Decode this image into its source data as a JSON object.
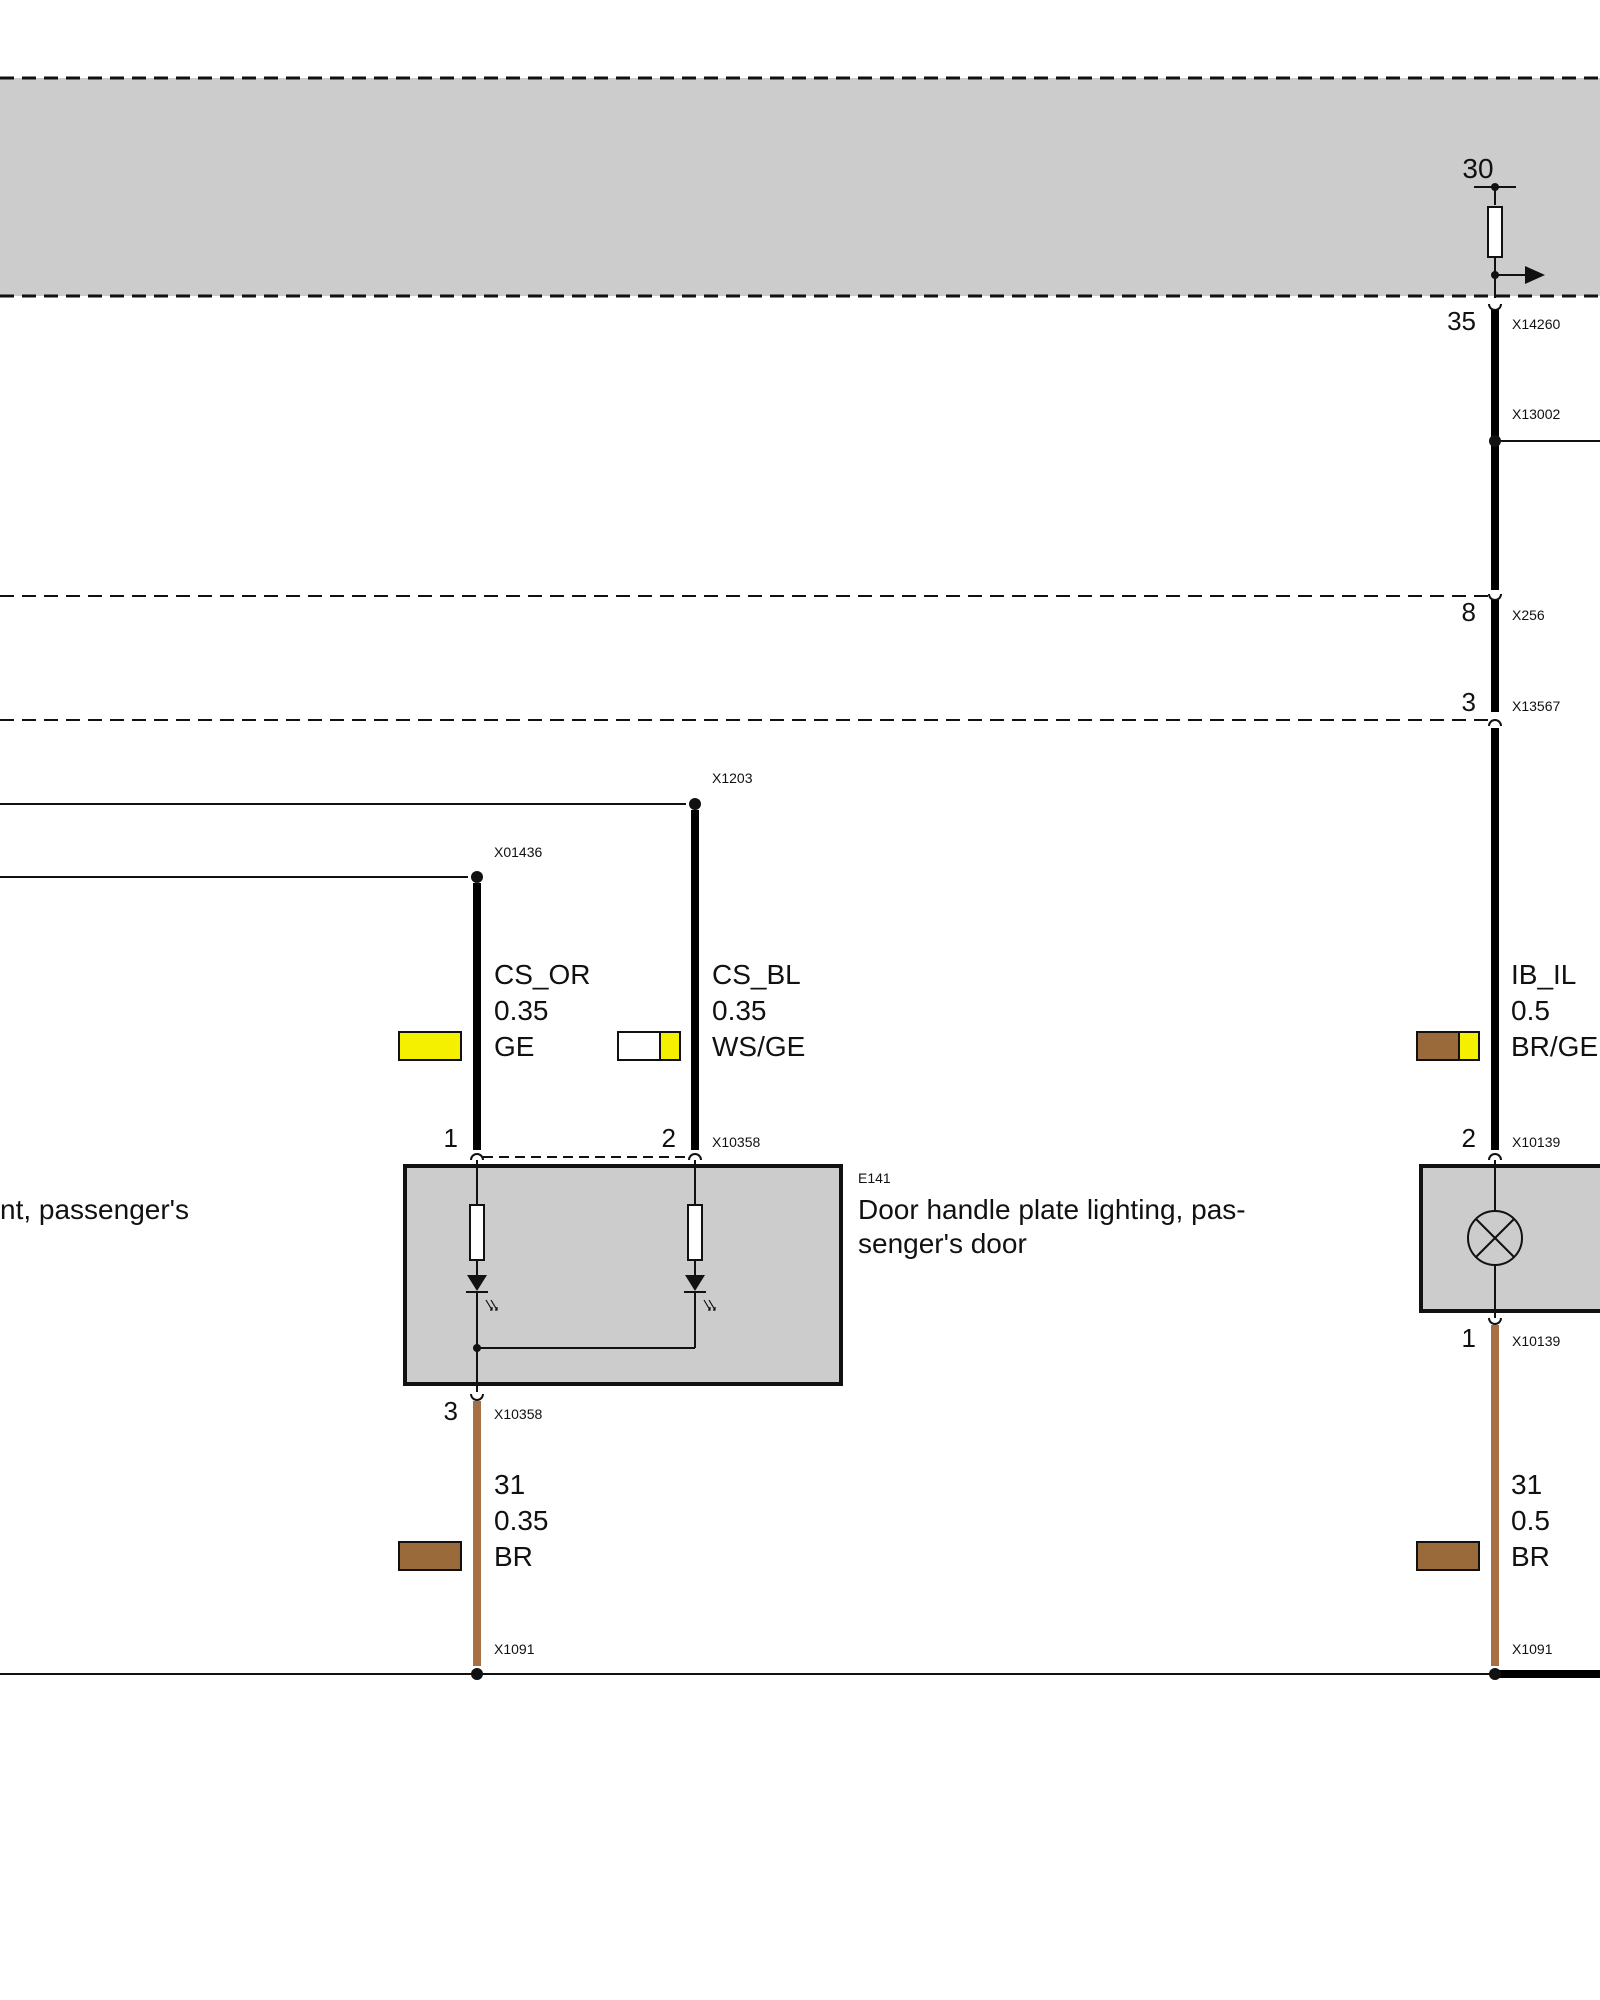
{
  "supply": {
    "terminal": "30",
    "connector": "X14260",
    "pin": "35"
  },
  "connectors": {
    "x13002": "X13002",
    "x256": "X256",
    "x256_pin": "8",
    "x13567": "X13567",
    "x13567_pin": "3",
    "x1203": "X1203",
    "x01436": "X01436"
  },
  "wires": [
    {
      "id": "cs-or",
      "signal": "CS_OR",
      "gauge": "0.35",
      "color_code": "GE",
      "swatch": [
        "#f5f000"
      ]
    },
    {
      "id": "cs-bl",
      "signal": "CS_BL",
      "gauge": "0.35",
      "color_code": "WS/GE",
      "swatch": [
        "#ffffff",
        "#f5f000"
      ]
    },
    {
      "id": "ib-il",
      "signal": "IB_IL",
      "gauge": "0.5",
      "color_code": "BR/GE",
      "swatch": [
        "#9a6a3a",
        "#f5f000"
      ]
    },
    {
      "id": "gnd-e141",
      "signal": "31",
      "gauge": "0.35",
      "color_code": "BR",
      "swatch": [
        "#9a6a3a"
      ]
    },
    {
      "id": "gnd-lamp",
      "signal": "31",
      "gauge": "0.5",
      "color_code": "BR",
      "swatch": [
        "#9a6a3a"
      ]
    }
  ],
  "e141": {
    "id": "E141",
    "name_line1": "Door handle plate lighting, pas-",
    "name_line2": "senger's door",
    "connector": "X10358",
    "pin1": "1",
    "pin2": "2",
    "pin3": "3"
  },
  "partial_component": {
    "name_fragment": "nt, passenger's"
  },
  "lamp": {
    "connector_top": "X10139",
    "pin_top": "2",
    "connector_bottom": "X10139",
    "pin_bottom": "1"
  },
  "ground": {
    "connector_left": "X1091",
    "connector_right": "X1091"
  },
  "colors": {
    "brown_wire": "#a77044",
    "housing": "#cccccc",
    "wire": "#000000"
  }
}
